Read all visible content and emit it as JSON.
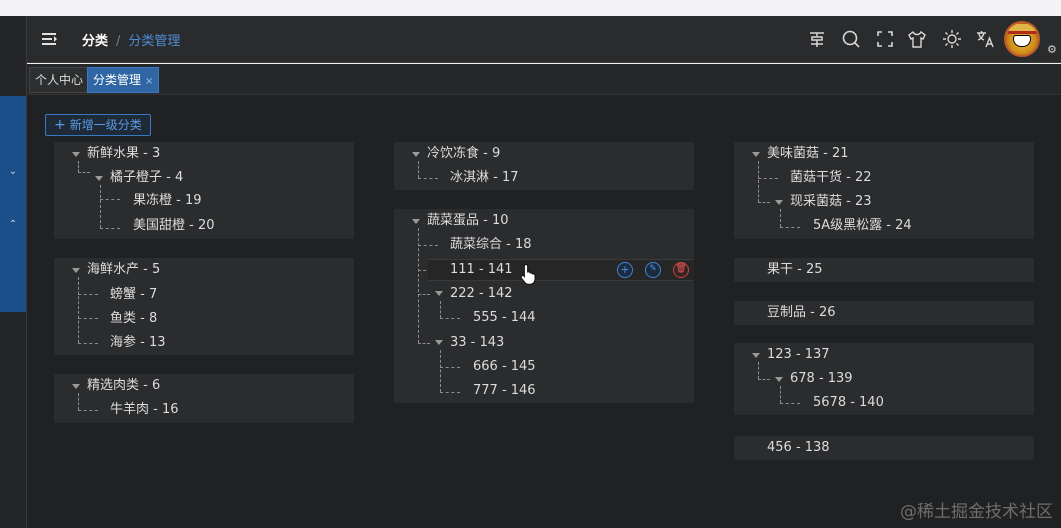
{
  "header": {
    "breadcrumb_root": "分类",
    "breadcrumb_sep": "/",
    "breadcrumb_current": "分类管理"
  },
  "tabs": [
    {
      "label": "个人中心"
    },
    {
      "label": "分类管理",
      "close": "×"
    }
  ],
  "main": {
    "add_button_icon": "+",
    "add_button": "新增一级分类",
    "actions": {
      "add": "+",
      "edit": "✎",
      "delete": "🗑"
    }
  },
  "tree": {
    "c1": {
      "n3": "新鲜水果 - 3",
      "n4": "橘子橙子 - 4",
      "n19": "果冻橙 - 19",
      "n20": "美国甜橙 - 20"
    },
    "c2": {
      "n5": "海鲜水产 - 5",
      "n7": "螃蟹 - 7",
      "n8": "鱼类 - 8",
      "n13": "海参 - 13"
    },
    "c3": {
      "n6": "精选肉类 - 6",
      "n16": "牛羊肉 - 16"
    },
    "c4": {
      "n9": "冷饮冻食 - 9",
      "n17": "冰淇淋 - 17"
    },
    "c5": {
      "n10": "蔬菜蛋品 - 10",
      "n18": "蔬菜综合 - 18",
      "n141": "111 - 141",
      "n142": "222 - 142",
      "n144": "555 - 144",
      "n143": "33 - 143",
      "n145": "666 - 145",
      "n146": "777 - 146"
    },
    "c6": {
      "n21": "美味菌菇 - 21",
      "n22": "菌菇干货 - 22",
      "n23": "现采菌菇 - 23",
      "n24": "5A级黑松露 - 24"
    },
    "c7": {
      "n25": "果干 - 25"
    },
    "c8": {
      "n26": "豆制品 - 26"
    },
    "c9": {
      "n137": "123 - 137",
      "n139": "678 - 139",
      "n140": "5678 - 140"
    },
    "c10": {
      "n138": "456 - 138"
    }
  },
  "icons": {
    "header": [
      "menu-fold-icon",
      "font-size-icon",
      "search-icon",
      "fullscreen-icon",
      "theme-skin-icon",
      "brightness-icon",
      "translate-icon",
      "avatar",
      "gear-icon"
    ]
  },
  "watermark": "@稀土掘金技术社区"
}
